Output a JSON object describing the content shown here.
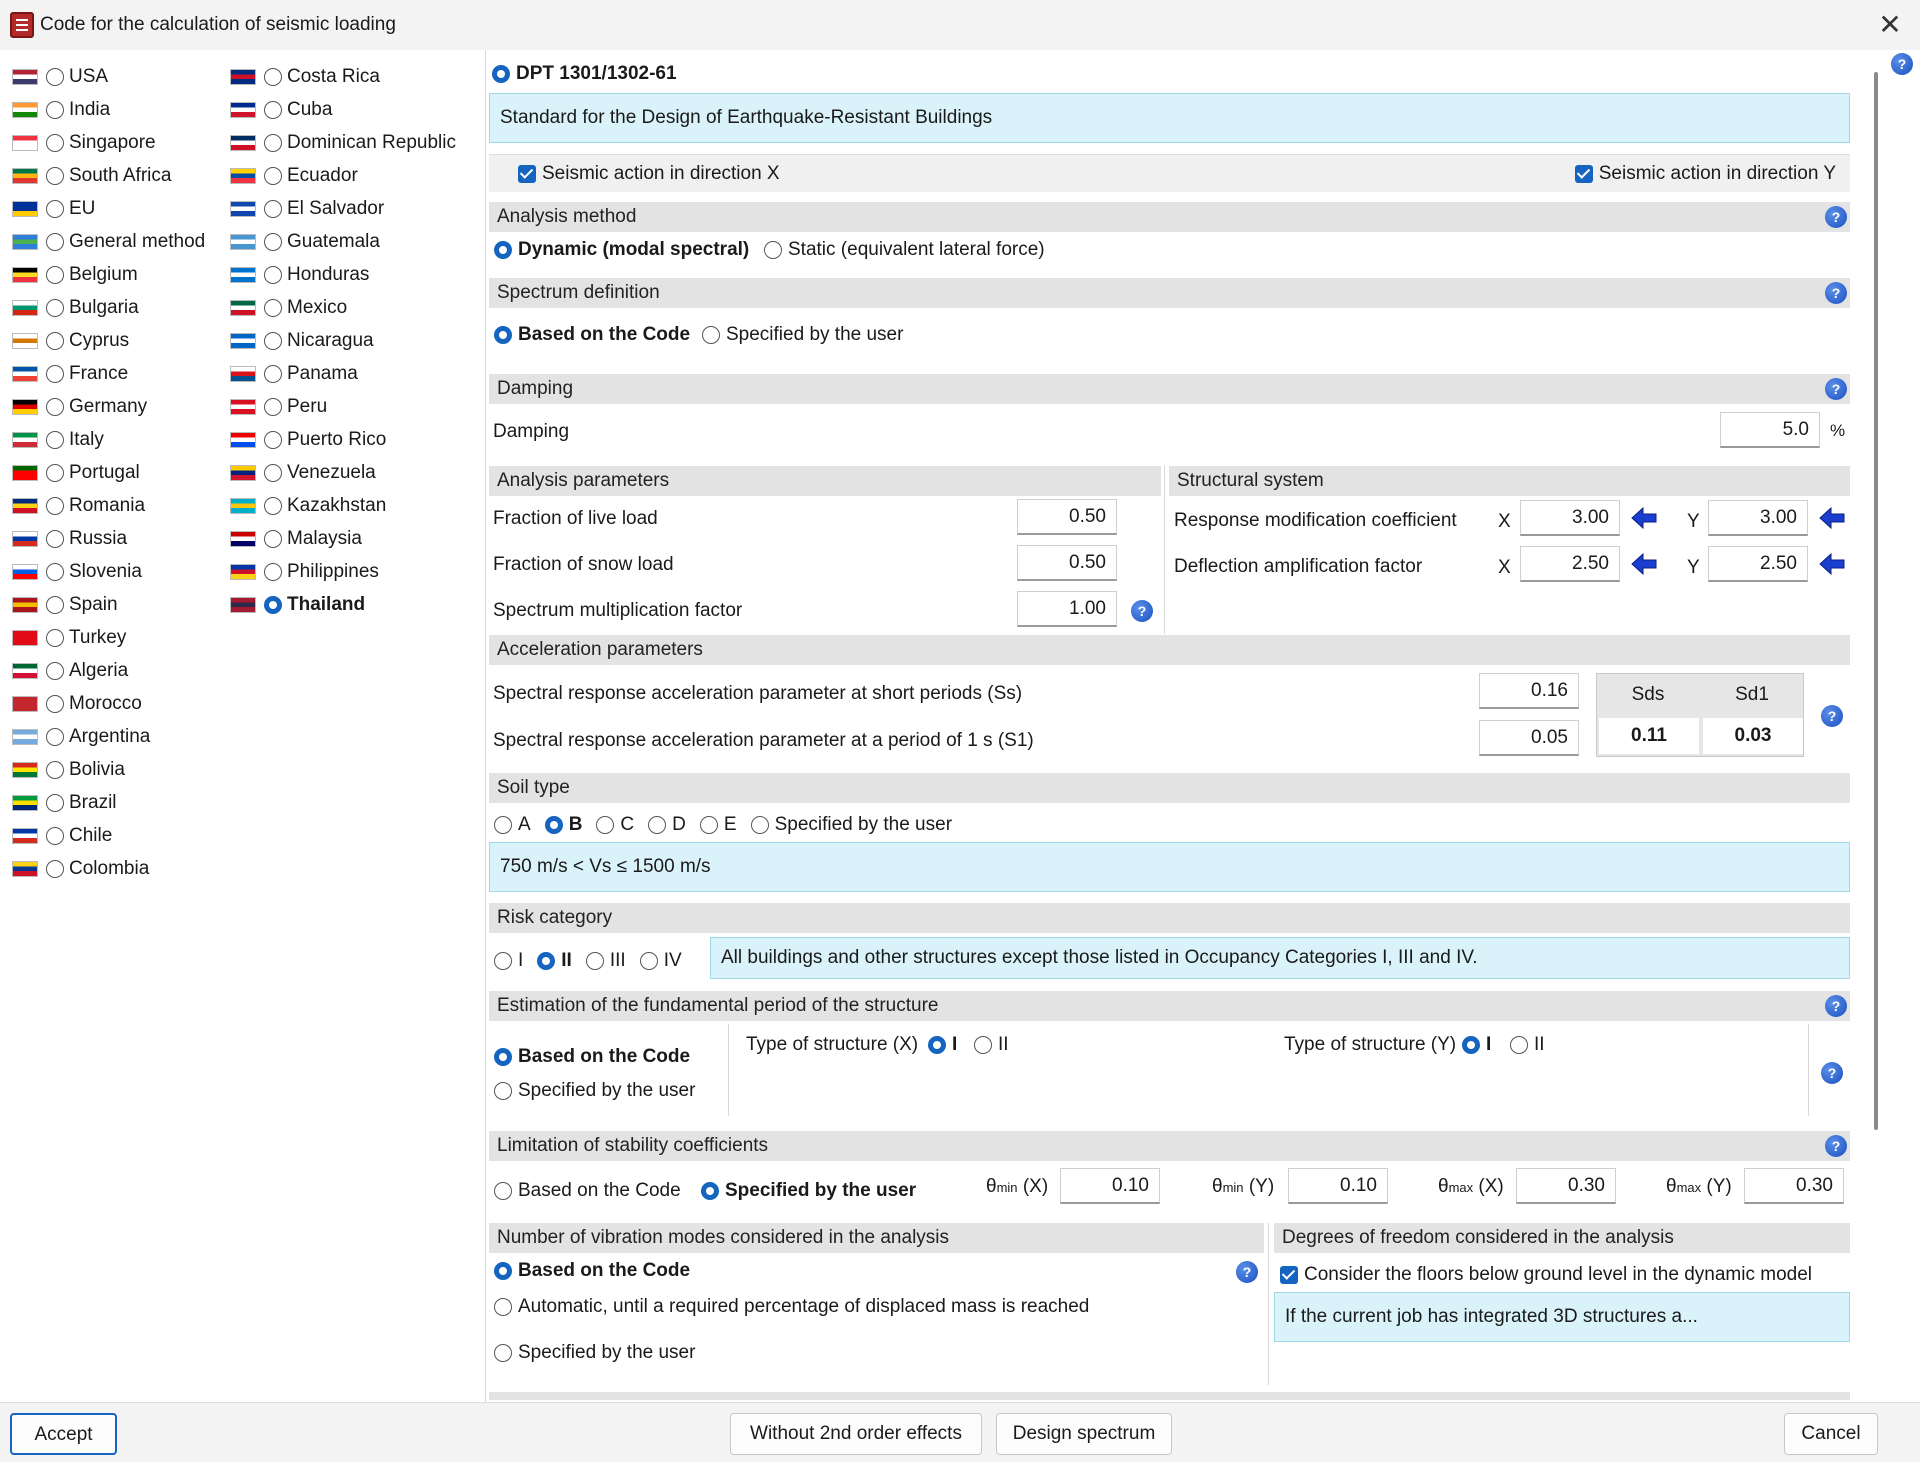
{
  "window": {
    "title": "Code for the calculation of seismic loading"
  },
  "countries_col1": [
    {
      "name": "USA",
      "flag": [
        "#b22234",
        "#ffffff",
        "#3c3b6e"
      ]
    },
    {
      "name": "India",
      "flag": [
        "#ff9933",
        "#ffffff",
        "#138808"
      ]
    },
    {
      "name": "Singapore",
      "flag": [
        "#ef3340",
        "#ffffff",
        "#ffffff"
      ]
    },
    {
      "name": "South Africa",
      "flag": [
        "#007749",
        "#ffb612",
        "#de3831"
      ]
    },
    {
      "name": "EU",
      "flag": [
        "#003399",
        "#003399",
        "#ffcc00"
      ]
    },
    {
      "name": "General method",
      "flag": [
        "#2d7fd8",
        "#4caf50",
        "#2d7fd8"
      ]
    },
    {
      "name": "Belgium",
      "flag": [
        "#000000",
        "#fdda24",
        "#ef3340"
      ]
    },
    {
      "name": "Bulgaria",
      "flag": [
        "#ffffff",
        "#00966e",
        "#d62612"
      ]
    },
    {
      "name": "Cyprus",
      "flag": [
        "#ffffff",
        "#d57800",
        "#ffffff"
      ]
    },
    {
      "name": "France",
      "flag": [
        "#0055a4",
        "#ffffff",
        "#ef4135"
      ]
    },
    {
      "name": "Germany",
      "flag": [
        "#000000",
        "#dd0000",
        "#ffce00"
      ]
    },
    {
      "name": "Italy",
      "flag": [
        "#009246",
        "#ffffff",
        "#ce2b37"
      ]
    },
    {
      "name": "Portugal",
      "flag": [
        "#006600",
        "#ff0000",
        "#ff0000"
      ]
    },
    {
      "name": "Romania",
      "flag": [
        "#002b7f",
        "#fcd116",
        "#ce1126"
      ]
    },
    {
      "name": "Russia",
      "flag": [
        "#ffffff",
        "#0039a6",
        "#d52b1e"
      ]
    },
    {
      "name": "Slovenia",
      "flag": [
        "#ffffff",
        "#005ce5",
        "#ff0000"
      ]
    },
    {
      "name": "Spain",
      "flag": [
        "#aa151b",
        "#f1bf00",
        "#aa151b"
      ]
    },
    {
      "name": "Turkey",
      "flag": [
        "#e30a17",
        "#e30a17",
        "#e30a17"
      ]
    },
    {
      "name": "Algeria",
      "flag": [
        "#006633",
        "#ffffff",
        "#d21034"
      ]
    },
    {
      "name": "Morocco",
      "flag": [
        "#c1272d",
        "#c1272d",
        "#c1272d"
      ]
    },
    {
      "name": "Argentina",
      "flag": [
        "#74acdf",
        "#ffffff",
        "#74acdf"
      ]
    },
    {
      "name": "Bolivia",
      "flag": [
        "#d52b1e",
        "#f9e300",
        "#007934"
      ]
    },
    {
      "name": "Brazil",
      "flag": [
        "#009c3b",
        "#ffdf00",
        "#002776"
      ]
    },
    {
      "name": "Chile",
      "flag": [
        "#0039a6",
        "#ffffff",
        "#d52b1e"
      ]
    },
    {
      "name": "Colombia",
      "flag": [
        "#fcd116",
        "#003893",
        "#ce1126"
      ]
    }
  ],
  "countries_col2": [
    {
      "name": "Costa Rica",
      "flag": [
        "#002b7f",
        "#ce1126",
        "#002b7f"
      ]
    },
    {
      "name": "Cuba",
      "flag": [
        "#002a8f",
        "#ffffff",
        "#cf142b"
      ]
    },
    {
      "name": "Dominican Republic",
      "flag": [
        "#002d62",
        "#ffffff",
        "#ce1126"
      ]
    },
    {
      "name": "Ecuador",
      "flag": [
        "#ffd100",
        "#034ea2",
        "#ef3340"
      ]
    },
    {
      "name": "El Salvador",
      "flag": [
        "#0f47af",
        "#ffffff",
        "#0f47af"
      ]
    },
    {
      "name": "Guatemala",
      "flag": [
        "#4997d0",
        "#ffffff",
        "#4997d0"
      ]
    },
    {
      "name": "Honduras",
      "flag": [
        "#0073cf",
        "#ffffff",
        "#0073cf"
      ]
    },
    {
      "name": "Mexico",
      "flag": [
        "#006847",
        "#ffffff",
        "#ce1126"
      ]
    },
    {
      "name": "Nicaragua",
      "flag": [
        "#0067c6",
        "#ffffff",
        "#0067c6"
      ]
    },
    {
      "name": "Panama",
      "flag": [
        "#ffffff",
        "#da121a",
        "#005293"
      ]
    },
    {
      "name": "Peru",
      "flag": [
        "#d91023",
        "#ffffff",
        "#d91023"
      ]
    },
    {
      "name": "Puerto Rico",
      "flag": [
        "#ed0000",
        "#ffffff",
        "#0050f0"
      ]
    },
    {
      "name": "Venezuela",
      "flag": [
        "#ffcc00",
        "#00247d",
        "#cf142b"
      ]
    },
    {
      "name": "Kazakhstan",
      "flag": [
        "#00afca",
        "#fec50c",
        "#00afca"
      ]
    },
    {
      "name": "Malaysia",
      "flag": [
        "#cc0001",
        "#ffffff",
        "#010066"
      ]
    },
    {
      "name": "Philippines",
      "flag": [
        "#0038a8",
        "#ce1126",
        "#fcd116"
      ]
    },
    {
      "name": "Thailand",
      "flag": [
        "#a51931",
        "#2d2a4a",
        "#a51931"
      ],
      "selected": true
    }
  ],
  "code": {
    "name": "DPT 1301/1302-61",
    "description": "Standard for the Design of Earthquake-Resistant Buildings"
  },
  "seismic": {
    "dir_x": "Seismic action in direction X",
    "dir_y": "Seismic action in direction Y"
  },
  "analysis_method": {
    "title": "Analysis method",
    "opt1": "Dynamic (modal spectral)",
    "opt2": "Static (equivalent lateral force)"
  },
  "spectrum": {
    "title": "Spectrum definition",
    "opt1": "Based on the Code",
    "opt2": "Specified by the user"
  },
  "damping": {
    "title": "Damping",
    "label": "Damping",
    "value": "5.0",
    "unit": "%"
  },
  "analysis_params": {
    "title": "Analysis parameters",
    "live_label": "Fraction of live load",
    "live_value": "0.50",
    "snow_label": "Fraction of snow load",
    "snow_value": "0.50",
    "spec_label": "Spectrum multiplication factor",
    "spec_value": "1.00"
  },
  "structural": {
    "title": "Structural system",
    "rmc_label": "Response modification coefficient",
    "daf_label": "Deflection amplification factor",
    "x": "X",
    "y": "Y",
    "rmc_x": "3.00",
    "rmc_y": "3.00",
    "daf_x": "2.50",
    "daf_y": "2.50"
  },
  "accel": {
    "title": "Acceleration parameters",
    "ss_label": "Spectral response acceleration parameter at short periods (Ss)",
    "ss_value": "0.16",
    "s1_label": "Spectral response acceleration parameter at a period of 1 s (S1)",
    "s1_value": "0.05",
    "sds_head": "Sds",
    "sd1_head": "Sd1",
    "sds_value": "0.11",
    "sd1_value": "0.03"
  },
  "soil": {
    "title": "Soil type",
    "options": [
      "A",
      "B",
      "C",
      "D",
      "E",
      "Specified by the user"
    ],
    "info": "750 m/s < Vs ≤ 1500 m/s"
  },
  "risk": {
    "title": "Risk category",
    "options": [
      "I",
      "II",
      "III",
      "IV"
    ],
    "info": "All buildings and other structures except those listed in Occupancy Categories I, III and IV."
  },
  "period": {
    "title": "Estimation of the fundamental period of the structure",
    "opt1": "Based on the Code",
    "opt2": "Specified by the user",
    "type_x": "Type of structure (X)",
    "type_y": "Type of structure (Y)",
    "i": "I",
    "ii": "II"
  },
  "stability": {
    "title": "Limitation of stability coefficients",
    "opt1": "Based on the Code",
    "opt2": "Specified by the user",
    "theta": "θ",
    "min": "min",
    "max": "max",
    "x": "(X)",
    "y": "(Y)",
    "min_x": "0.10",
    "min_y": "0.10",
    "max_x": "0.30",
    "max_y": "0.30"
  },
  "modes": {
    "title": "Number of vibration modes considered in the analysis",
    "opt1": "Based on the Code",
    "opt2": "Automatic, until a required percentage of displaced mass is reached",
    "opt3": "Specified by the user"
  },
  "dof": {
    "title": "Degrees of freedom considered in the analysis",
    "check": "Consider the floors below ground level in the dynamic model",
    "info": "If the current job has integrated 3D structures a..."
  },
  "buttons": {
    "accept": "Accept",
    "without": "Without 2nd order effects",
    "design": "Design spectrum",
    "cancel": "Cancel"
  },
  "help_glyph": "?",
  "close_glyph": "✕",
  "colors": {
    "accent": "#1565c0",
    "section_bg": "#e3e3e3",
    "info_bg": "#daf3fb"
  }
}
